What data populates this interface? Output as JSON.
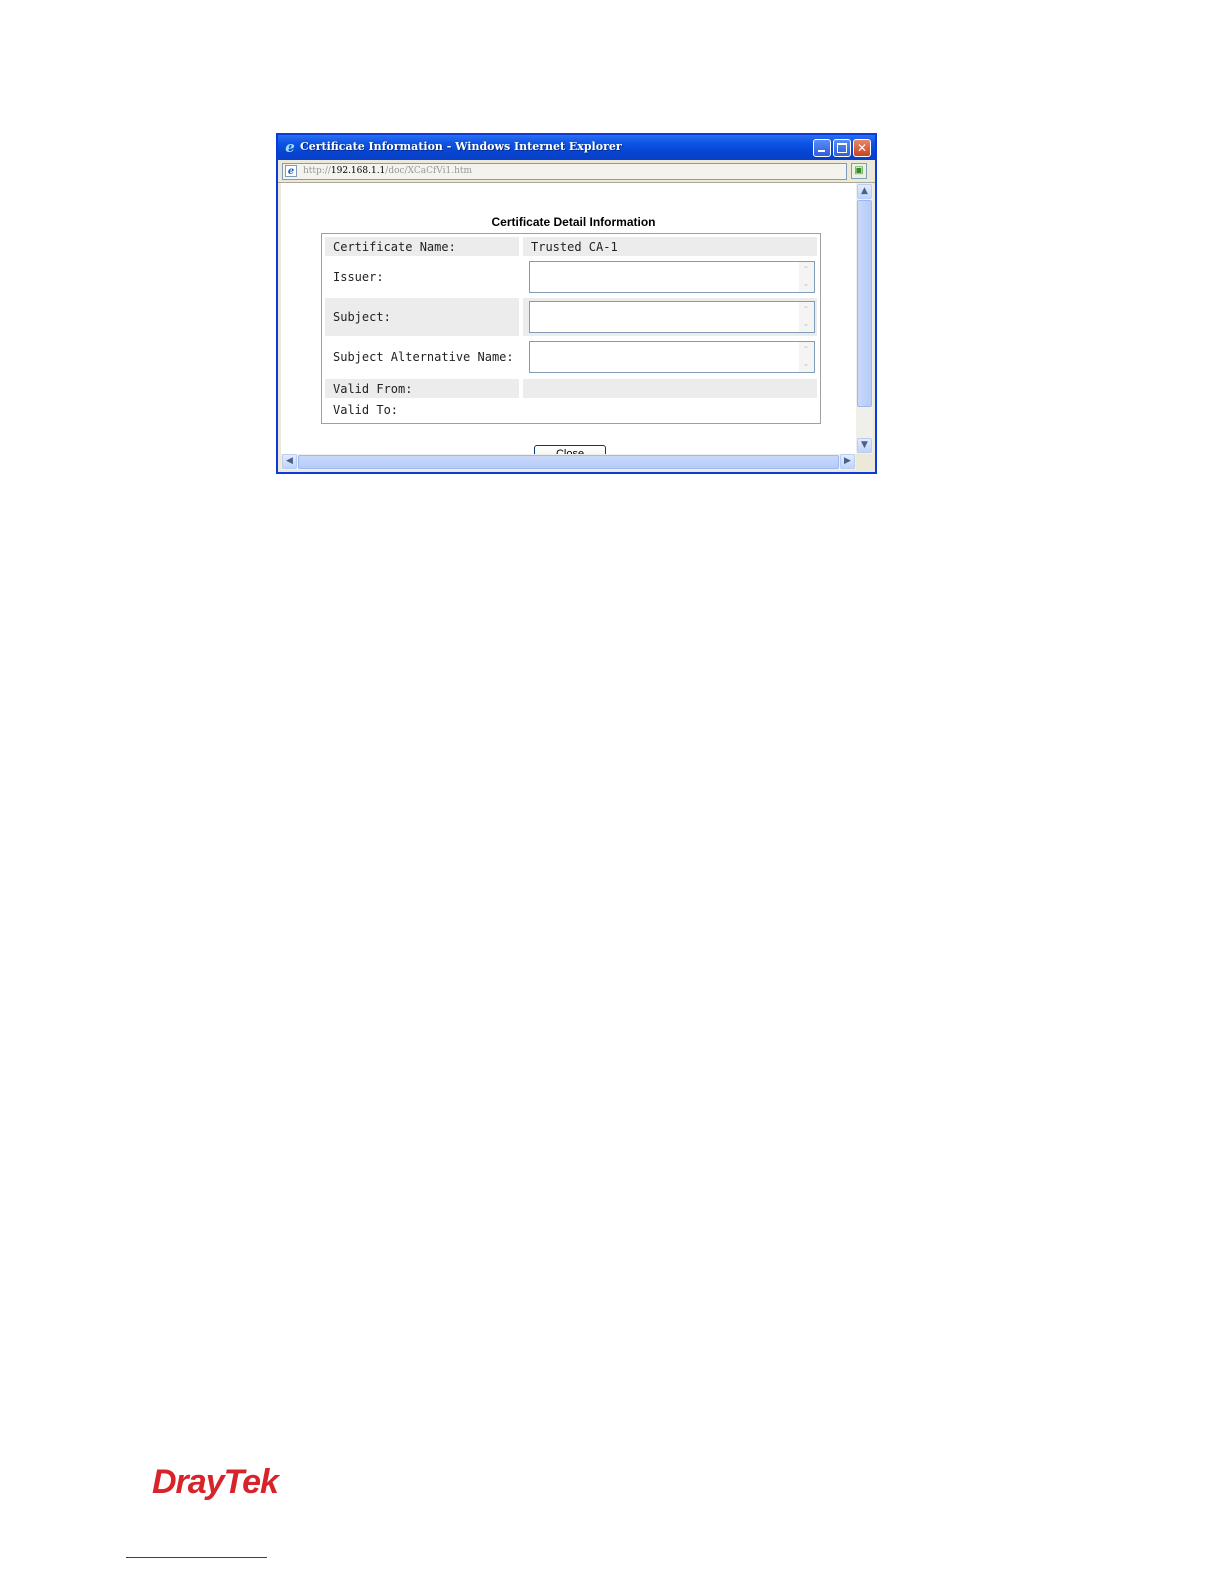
{
  "window": {
    "title": "Certificate Information - Windows Internet Explorer",
    "url_prefix": "http://",
    "url_host": "192.168.1.1",
    "url_path": "/doc/XCaCfVi1.htm",
    "minimize_glyph": "",
    "maximize_glyph": "",
    "close_glyph": "✕"
  },
  "dialog": {
    "heading": "Certificate Detail Information",
    "rows": [
      {
        "label": "Certificate Name:",
        "value": "Trusted CA-1"
      },
      {
        "label": "Issuer:",
        "value": ""
      },
      {
        "label": "Subject:",
        "value": ""
      },
      {
        "label": "Subject Alternative Name:",
        "value": ""
      },
      {
        "label": "Valid From:",
        "value": ""
      },
      {
        "label": "Valid To:",
        "value": ""
      }
    ],
    "close_label": "Close"
  },
  "scrollbars": {
    "up": "▲",
    "down": "▼",
    "left": "◀",
    "right": "▶"
  },
  "footer": {
    "logo": "DrayTek"
  },
  "colors": {
    "titlebar": "#0a3fc6",
    "logo": "#d8232a"
  },
  "icons": [
    "ie-logo-icon",
    "page-icon",
    "go-icon",
    "minimize-icon",
    "maximize-icon",
    "close-icon"
  ]
}
